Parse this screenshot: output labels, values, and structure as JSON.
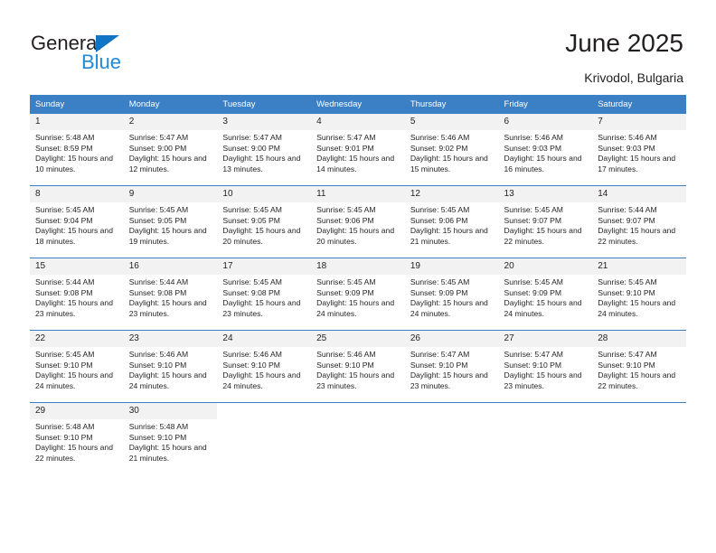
{
  "brand": {
    "name_top": "General",
    "name_bottom": "Blue",
    "accent_color": "#1f8ad6",
    "triangle_color": "#1175c4"
  },
  "header": {
    "title": "June 2025",
    "subtitle": "Krivodol, Bulgaria",
    "header_bg": "#3b7fc4",
    "daynum_bg": "#f2f2f2"
  },
  "weekday_headers": [
    "Sunday",
    "Monday",
    "Tuesday",
    "Wednesday",
    "Thursday",
    "Friday",
    "Saturday"
  ],
  "labels": {
    "sunrise_prefix": "Sunrise:",
    "sunset_prefix": "Sunset:",
    "daylight_prefix": "Daylight:"
  },
  "weeks": [
    [
      {
        "day": "1",
        "sunrise": "Sunrise: 5:48 AM",
        "sunset": "Sunset: 8:59 PM",
        "daylight": "Daylight: 15 hours and 10 minutes."
      },
      {
        "day": "2",
        "sunrise": "Sunrise: 5:47 AM",
        "sunset": "Sunset: 9:00 PM",
        "daylight": "Daylight: 15 hours and 12 minutes."
      },
      {
        "day": "3",
        "sunrise": "Sunrise: 5:47 AM",
        "sunset": "Sunset: 9:00 PM",
        "daylight": "Daylight: 15 hours and 13 minutes."
      },
      {
        "day": "4",
        "sunrise": "Sunrise: 5:47 AM",
        "sunset": "Sunset: 9:01 PM",
        "daylight": "Daylight: 15 hours and 14 minutes."
      },
      {
        "day": "5",
        "sunrise": "Sunrise: 5:46 AM",
        "sunset": "Sunset: 9:02 PM",
        "daylight": "Daylight: 15 hours and 15 minutes."
      },
      {
        "day": "6",
        "sunrise": "Sunrise: 5:46 AM",
        "sunset": "Sunset: 9:03 PM",
        "daylight": "Daylight: 15 hours and 16 minutes."
      },
      {
        "day": "7",
        "sunrise": "Sunrise: 5:46 AM",
        "sunset": "Sunset: 9:03 PM",
        "daylight": "Daylight: 15 hours and 17 minutes."
      }
    ],
    [
      {
        "day": "8",
        "sunrise": "Sunrise: 5:45 AM",
        "sunset": "Sunset: 9:04 PM",
        "daylight": "Daylight: 15 hours and 18 minutes."
      },
      {
        "day": "9",
        "sunrise": "Sunrise: 5:45 AM",
        "sunset": "Sunset: 9:05 PM",
        "daylight": "Daylight: 15 hours and 19 minutes."
      },
      {
        "day": "10",
        "sunrise": "Sunrise: 5:45 AM",
        "sunset": "Sunset: 9:05 PM",
        "daylight": "Daylight: 15 hours and 20 minutes."
      },
      {
        "day": "11",
        "sunrise": "Sunrise: 5:45 AM",
        "sunset": "Sunset: 9:06 PM",
        "daylight": "Daylight: 15 hours and 20 minutes."
      },
      {
        "day": "12",
        "sunrise": "Sunrise: 5:45 AM",
        "sunset": "Sunset: 9:06 PM",
        "daylight": "Daylight: 15 hours and 21 minutes."
      },
      {
        "day": "13",
        "sunrise": "Sunrise: 5:45 AM",
        "sunset": "Sunset: 9:07 PM",
        "daylight": "Daylight: 15 hours and 22 minutes."
      },
      {
        "day": "14",
        "sunrise": "Sunrise: 5:44 AM",
        "sunset": "Sunset: 9:07 PM",
        "daylight": "Daylight: 15 hours and 22 minutes."
      }
    ],
    [
      {
        "day": "15",
        "sunrise": "Sunrise: 5:44 AM",
        "sunset": "Sunset: 9:08 PM",
        "daylight": "Daylight: 15 hours and 23 minutes."
      },
      {
        "day": "16",
        "sunrise": "Sunrise: 5:44 AM",
        "sunset": "Sunset: 9:08 PM",
        "daylight": "Daylight: 15 hours and 23 minutes."
      },
      {
        "day": "17",
        "sunrise": "Sunrise: 5:45 AM",
        "sunset": "Sunset: 9:08 PM",
        "daylight": "Daylight: 15 hours and 23 minutes."
      },
      {
        "day": "18",
        "sunrise": "Sunrise: 5:45 AM",
        "sunset": "Sunset: 9:09 PM",
        "daylight": "Daylight: 15 hours and 24 minutes."
      },
      {
        "day": "19",
        "sunrise": "Sunrise: 5:45 AM",
        "sunset": "Sunset: 9:09 PM",
        "daylight": "Daylight: 15 hours and 24 minutes."
      },
      {
        "day": "20",
        "sunrise": "Sunrise: 5:45 AM",
        "sunset": "Sunset: 9:09 PM",
        "daylight": "Daylight: 15 hours and 24 minutes."
      },
      {
        "day": "21",
        "sunrise": "Sunrise: 5:45 AM",
        "sunset": "Sunset: 9:10 PM",
        "daylight": "Daylight: 15 hours and 24 minutes."
      }
    ],
    [
      {
        "day": "22",
        "sunrise": "Sunrise: 5:45 AM",
        "sunset": "Sunset: 9:10 PM",
        "daylight": "Daylight: 15 hours and 24 minutes."
      },
      {
        "day": "23",
        "sunrise": "Sunrise: 5:46 AM",
        "sunset": "Sunset: 9:10 PM",
        "daylight": "Daylight: 15 hours and 24 minutes."
      },
      {
        "day": "24",
        "sunrise": "Sunrise: 5:46 AM",
        "sunset": "Sunset: 9:10 PM",
        "daylight": "Daylight: 15 hours and 24 minutes."
      },
      {
        "day": "25",
        "sunrise": "Sunrise: 5:46 AM",
        "sunset": "Sunset: 9:10 PM",
        "daylight": "Daylight: 15 hours and 23 minutes."
      },
      {
        "day": "26",
        "sunrise": "Sunrise: 5:47 AM",
        "sunset": "Sunset: 9:10 PM",
        "daylight": "Daylight: 15 hours and 23 minutes."
      },
      {
        "day": "27",
        "sunrise": "Sunrise: 5:47 AM",
        "sunset": "Sunset: 9:10 PM",
        "daylight": "Daylight: 15 hours and 23 minutes."
      },
      {
        "day": "28",
        "sunrise": "Sunrise: 5:47 AM",
        "sunset": "Sunset: 9:10 PM",
        "daylight": "Daylight: 15 hours and 22 minutes."
      }
    ],
    [
      {
        "day": "29",
        "sunrise": "Sunrise: 5:48 AM",
        "sunset": "Sunset: 9:10 PM",
        "daylight": "Daylight: 15 hours and 22 minutes."
      },
      {
        "day": "30",
        "sunrise": "Sunrise: 5:48 AM",
        "sunset": "Sunset: 9:10 PM",
        "daylight": "Daylight: 15 hours and 21 minutes."
      },
      {
        "day": "",
        "sunrise": "",
        "sunset": "",
        "daylight": ""
      },
      {
        "day": "",
        "sunrise": "",
        "sunset": "",
        "daylight": ""
      },
      {
        "day": "",
        "sunrise": "",
        "sunset": "",
        "daylight": ""
      },
      {
        "day": "",
        "sunrise": "",
        "sunset": "",
        "daylight": ""
      },
      {
        "day": "",
        "sunrise": "",
        "sunset": "",
        "daylight": ""
      }
    ]
  ]
}
